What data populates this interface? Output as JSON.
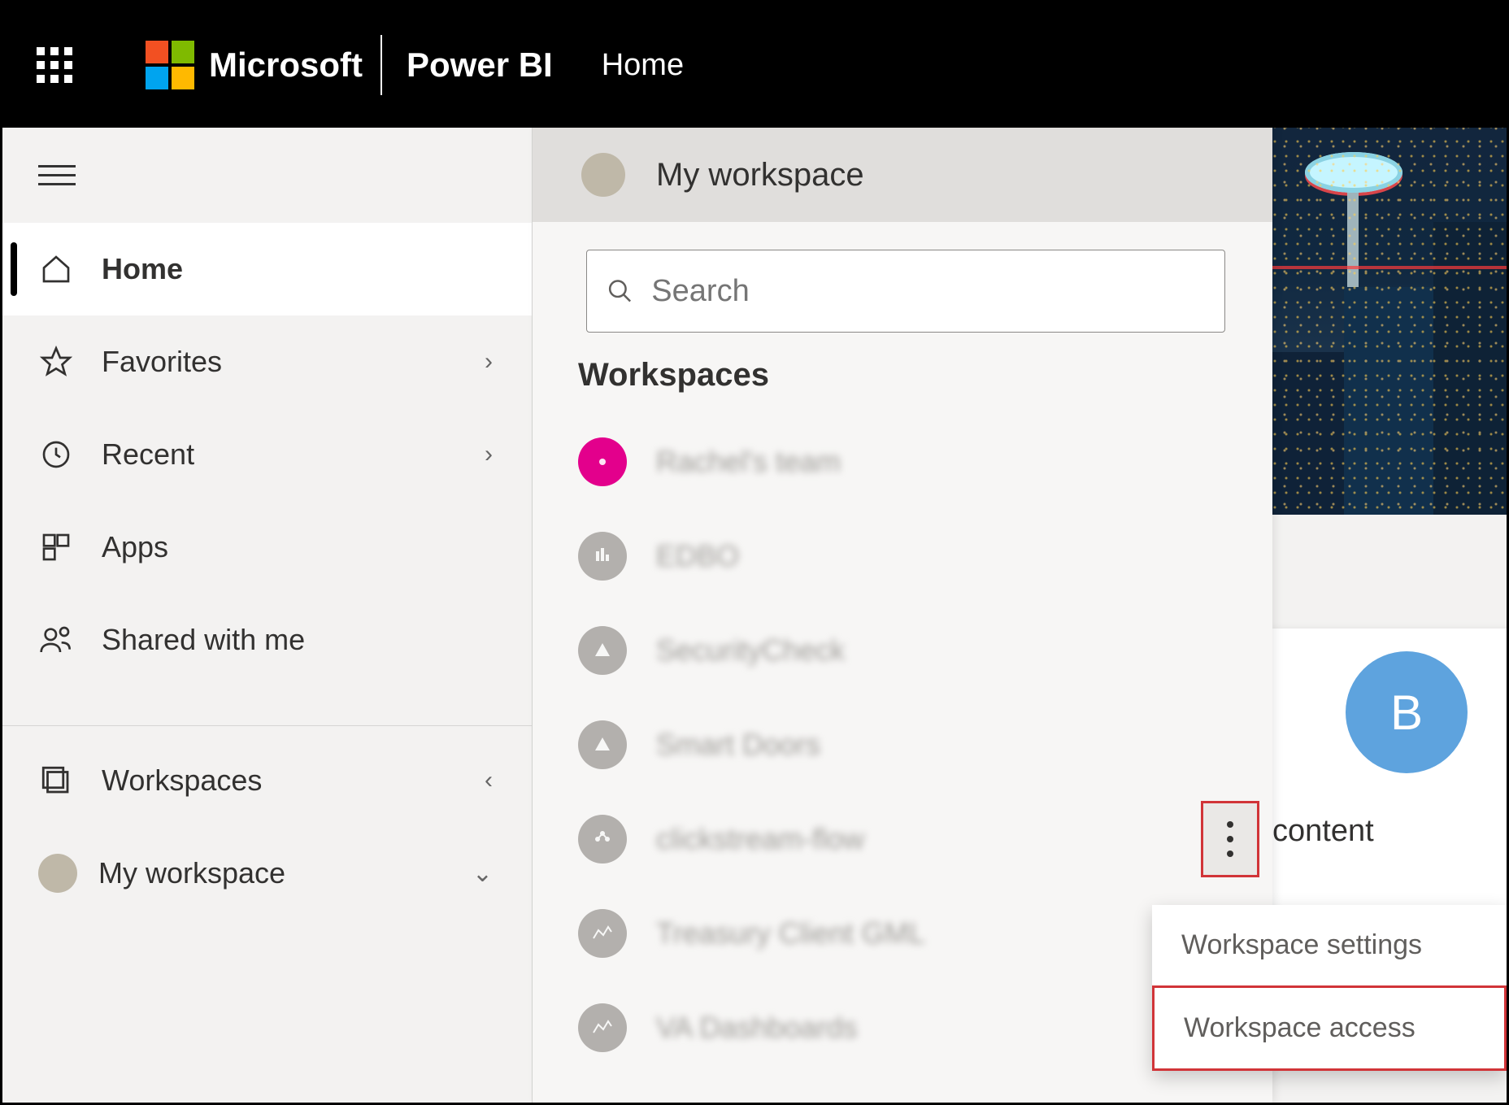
{
  "topbar": {
    "brand": "Microsoft",
    "product": "Power BI",
    "breadcrumb": "Home"
  },
  "sidebar": {
    "items": [
      {
        "label": "Home",
        "icon": "home-icon",
        "active": true,
        "chevron": false
      },
      {
        "label": "Favorites",
        "icon": "star-icon",
        "active": false,
        "chevron": true
      },
      {
        "label": "Recent",
        "icon": "clock-icon",
        "active": false,
        "chevron": true
      },
      {
        "label": "Apps",
        "icon": "apps-icon",
        "active": false,
        "chevron": false
      },
      {
        "label": "Shared with me",
        "icon": "shared-icon",
        "active": false,
        "chevron": false
      }
    ],
    "lowerItems": [
      {
        "label": "Workspaces",
        "icon": "workspaces-icon",
        "chevron": "left"
      },
      {
        "label": "My workspace",
        "icon": "avatar",
        "chevron": "down"
      }
    ]
  },
  "flyout": {
    "myWorkspaceLabel": "My workspace",
    "searchPlaceholder": "Search",
    "sectionTitle": "Workspaces",
    "workspaces": [
      {
        "name": "Rachel's team",
        "color": "pink"
      },
      {
        "name": "EDBO",
        "color": "gray"
      },
      {
        "name": "SecurityCheck",
        "color": "gray"
      },
      {
        "name": "Smart Doors",
        "color": "gray"
      },
      {
        "name": "clickstream-flow",
        "color": "gray"
      },
      {
        "name": "Treasury Client GML",
        "color": "gray"
      },
      {
        "name": "VA Dashboards",
        "color": "gray"
      }
    ]
  },
  "contextMenu": {
    "items": [
      {
        "label": "Workspace settings",
        "highlight": false
      },
      {
        "label": "Workspace access",
        "highlight": true
      }
    ]
  },
  "backgroundCard": {
    "avatarLetter": "B",
    "label": "content"
  }
}
